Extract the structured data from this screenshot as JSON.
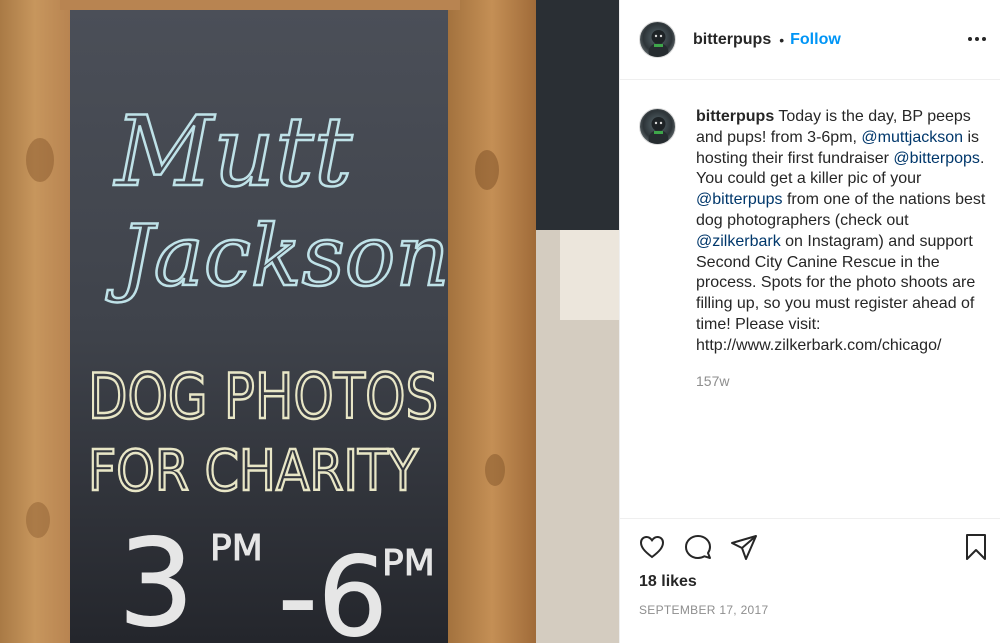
{
  "post": {
    "username": "bitterpups",
    "dot": "•",
    "follow_label": "Follow",
    "more_icon": "more-options-icon",
    "image_alt": "Chalkboard sign reading Mutt Jackson Dog Photos For Charity 3 PM - 6 PM",
    "sign_text": {
      "line1": "Mutt",
      "line2": "Jackson",
      "line3": "DOG PHOTOS",
      "line4": "FOR CHARITY",
      "time_start": "3",
      "time_end": "-6",
      "pm": "PM"
    }
  },
  "caption": {
    "username": "bitterpups",
    "segments": [
      {
        "text": " Today is the day, BP peeps and pups! from 3-6pm, "
      },
      {
        "mention": "@muttjackson"
      },
      {
        "text": " is hosting their first fundraiser "
      },
      {
        "mention": "@bitterpops"
      },
      {
        "text": ". You could get a killer pic of your "
      },
      {
        "mention": "@bitterpups"
      },
      {
        "text": " from one of the nations best dog photographers (check out "
      },
      {
        "mention": "@zilkerbark"
      },
      {
        "text": " on Instagram) and support Second City Canine Rescue in the process. Spots for the photo shoots are filling up, so you must register ahead of time! Please visit: http://www.zilkerbark.com/chicago/"
      }
    ],
    "time_ago": "157w"
  },
  "footer": {
    "likes": "18 likes",
    "date": "SEPTEMBER 17, 2017",
    "icons": [
      "heart-icon",
      "comment-icon",
      "share-icon",
      "bookmark-icon"
    ]
  },
  "colors": {
    "follow": "#0095f6",
    "mention": "#00376b",
    "muted": "#8e8e8e"
  }
}
